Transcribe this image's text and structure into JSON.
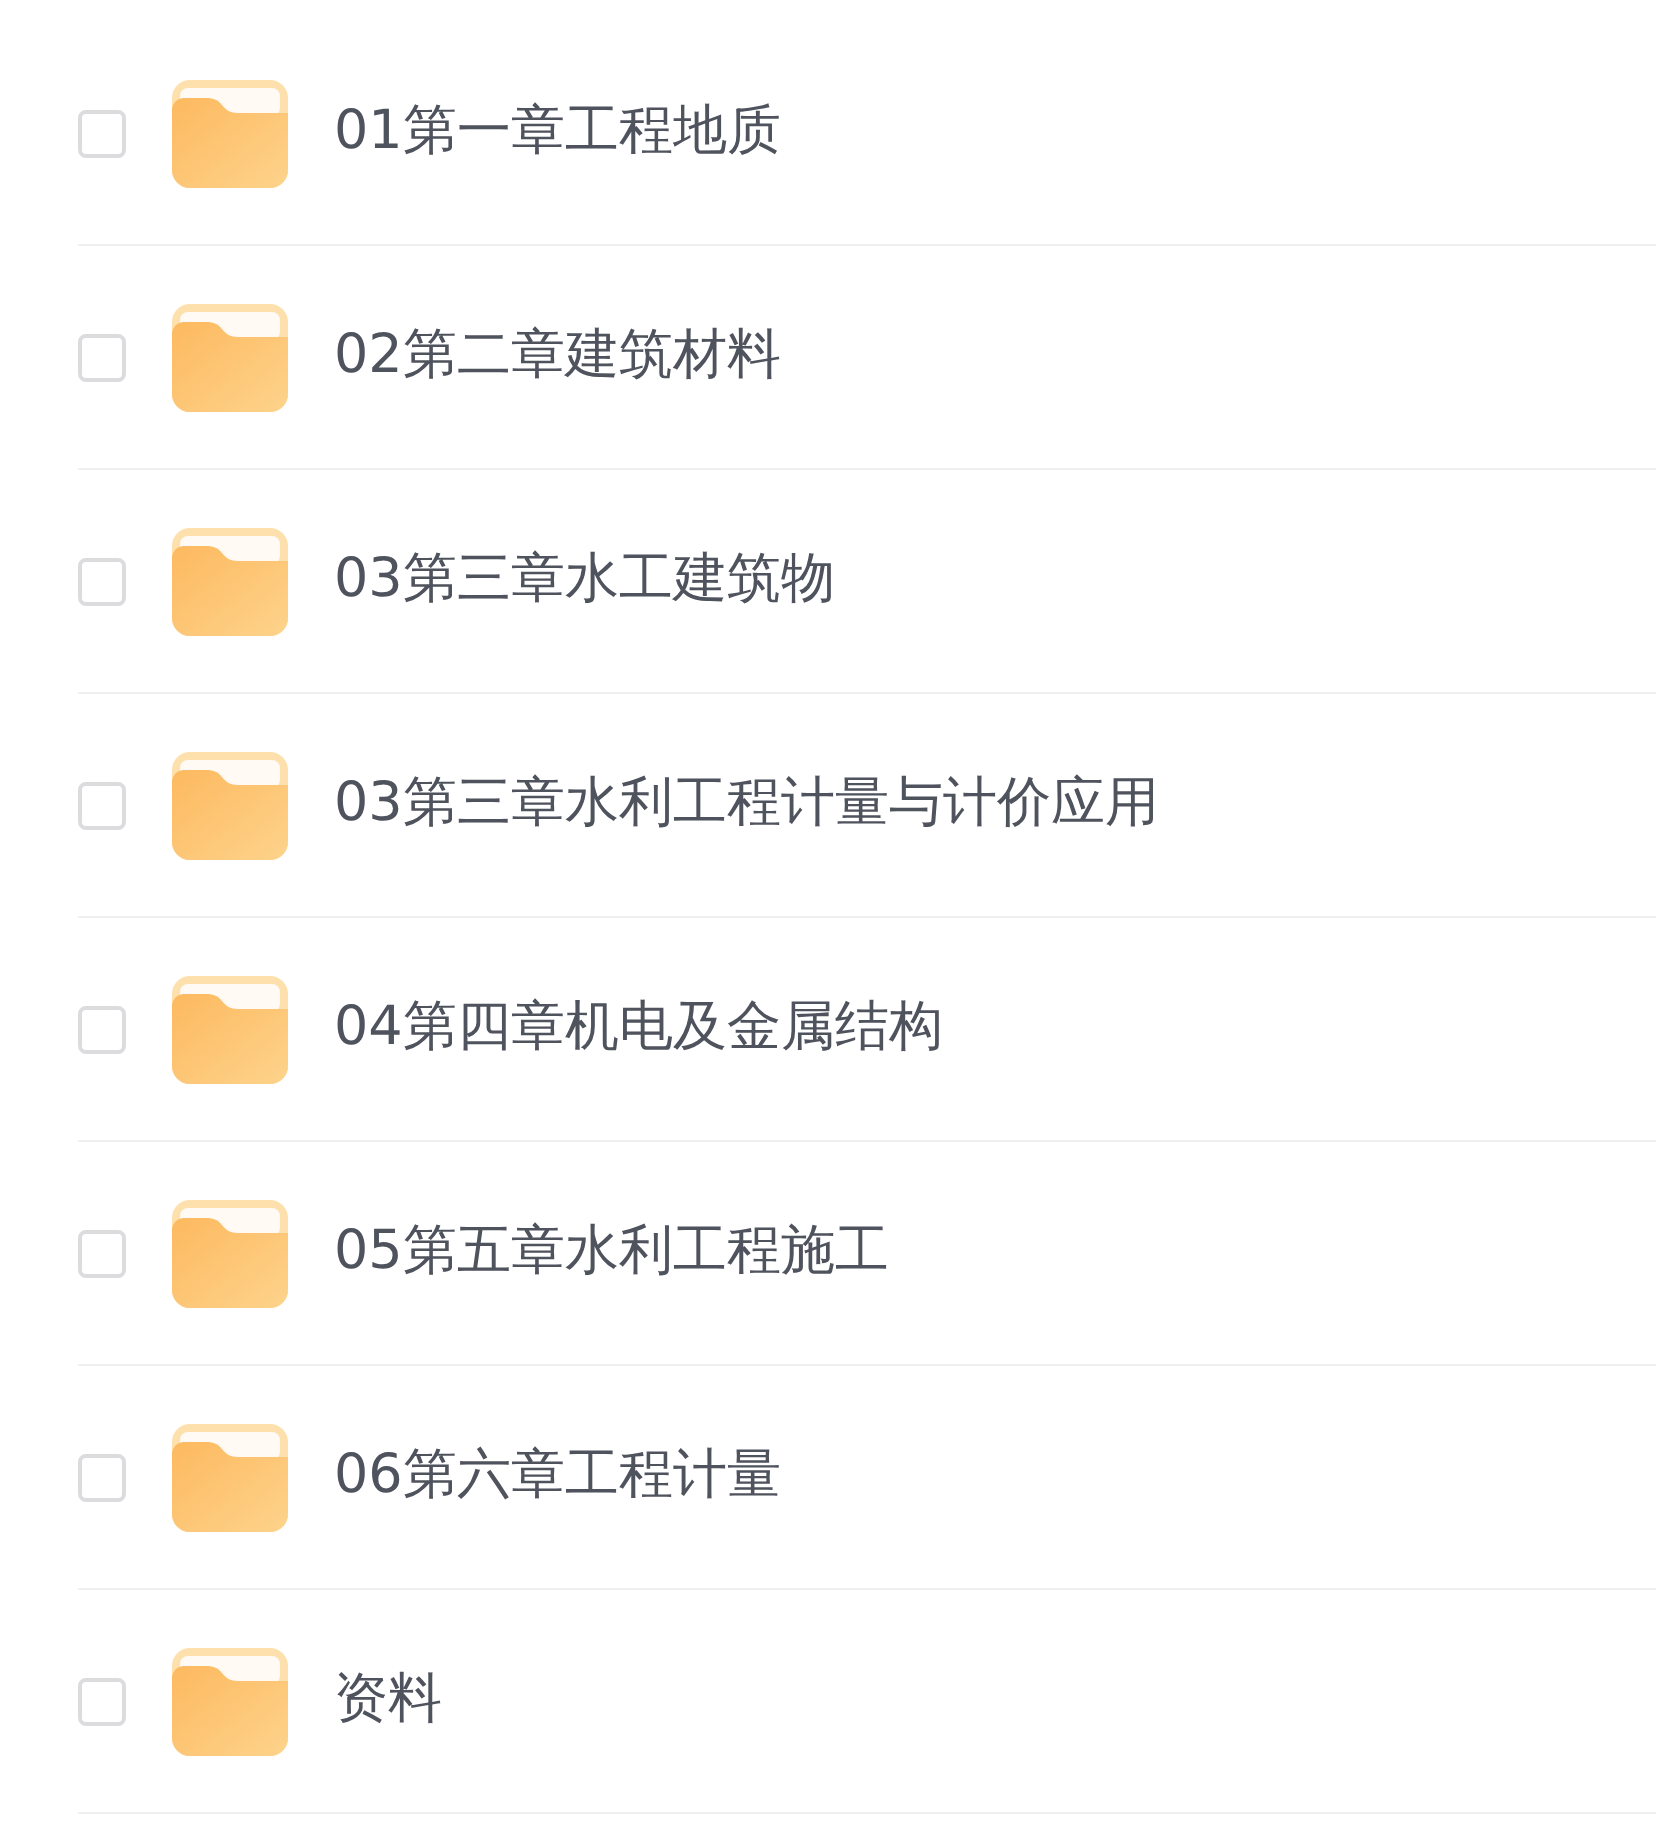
{
  "folders": [
    {
      "name": "01第一章工程地质",
      "checked": false
    },
    {
      "name": "02第二章建筑材料",
      "checked": false
    },
    {
      "name": "03第三章水工建筑物",
      "checked": false
    },
    {
      "name": "03第三章水利工程计量与计价应用",
      "checked": false
    },
    {
      "name": "04第四章机电及金属结构",
      "checked": false
    },
    {
      "name": "05第五章水利工程施工",
      "checked": false
    },
    {
      "name": "06第六章工程计量",
      "checked": false
    },
    {
      "name": "资料",
      "checked": false
    }
  ]
}
